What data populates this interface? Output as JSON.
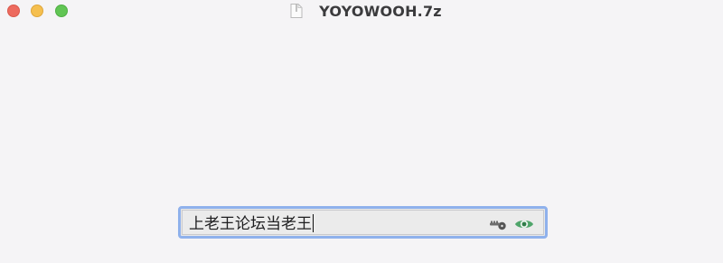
{
  "window": {
    "title": "YOYOWOOH.7z"
  },
  "password_field": {
    "value": "上老王论坛当老王"
  },
  "icons": {
    "document": "document-icon",
    "key": "key-icon",
    "reveal_password": "eye-icon"
  },
  "colors": {
    "focus_ring": "#8fb1ec",
    "eye_icon": "#4fa56a",
    "close": "#ed6a5e",
    "minimize": "#f5bf4f",
    "maximize": "#61c554"
  }
}
